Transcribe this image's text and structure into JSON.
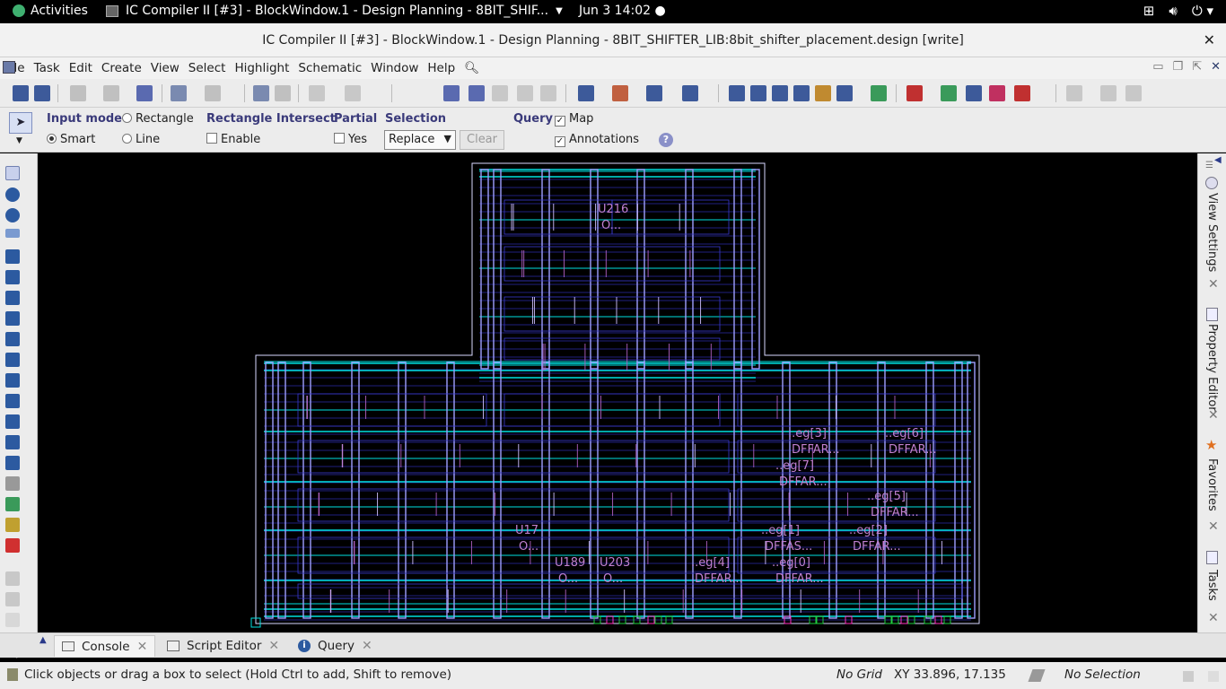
{
  "os_bar": {
    "activities": "Activities",
    "app_title": "IC Compiler II [#3] - BlockWindow.1 - Design Planning - 8BIT_SHIF...",
    "clock": "Jun 3  14:02"
  },
  "window": {
    "title": "IC Compiler II [#3] - BlockWindow.1 - Design Planning - 8BIT_SHIFTER_LIB:8bit_shifter_placement.design [write]"
  },
  "menu": [
    "File",
    "Task",
    "Edit",
    "Create",
    "View",
    "Select",
    "Highlight",
    "Schematic",
    "Window",
    "Help"
  ],
  "toolbar": {
    "spin_value": "0"
  },
  "options": {
    "input_mode": {
      "label": "Input mode",
      "smart": "Smart",
      "rectangle": "Rectangle",
      "line": "Line",
      "selected": "Smart"
    },
    "rect_intersect": {
      "label": "Rectangle Intersect",
      "enable": "Enable",
      "checked": false
    },
    "partial": {
      "label": "Partial",
      "yes": "Yes",
      "checked": false
    },
    "selection": {
      "label": "Selection",
      "value": "Replace",
      "clear": "Clear"
    },
    "query": {
      "label": "Query",
      "map": "Map",
      "annotations": "Annotations",
      "map_checked": true,
      "annotations_checked": true
    }
  },
  "cells": [
    {
      "name": "U216",
      "type": "O..."
    },
    {
      "name": "..eg[3]",
      "type": "DFFAR..."
    },
    {
      "name": "..eg[6]",
      "type": "DFFAR..."
    },
    {
      "name": "..eg[7]",
      "type": "DFFAR..."
    },
    {
      "name": "..eg[5]",
      "type": "DFFAR..."
    },
    {
      "name": "U17",
      "type": "O..."
    },
    {
      "name": "..eg[1]",
      "type": "DFFAS..."
    },
    {
      "name": "..eg[2]",
      "type": "DFFAR..."
    },
    {
      "name": "U189",
      "type": "O..."
    },
    {
      "name": "U203",
      "type": "O..."
    },
    {
      "name": "..eg[4]",
      "type": "DFFAR..."
    },
    {
      "name": "..eg[0]",
      "type": "DFFAR..."
    }
  ],
  "side_panels": [
    "View Settings",
    "Property Editor",
    "Favorites",
    "Tasks"
  ],
  "bottom_tabs": [
    "Console",
    "Script Editor",
    "Query"
  ],
  "status": {
    "hint": "Click objects or drag a box to select (Hold Ctrl to add, Shift to remove)",
    "grid": "No Grid",
    "xy": "XY 33.896, 17.135",
    "selection": "No Selection"
  },
  "colors": {
    "core_line": "#d8d8ff",
    "rail": "#9f9fff",
    "cyan": "#00e0e0",
    "cell_text": "#c080d0",
    "pin_green": "#20d040",
    "pin_magenta": "#ff30c0"
  }
}
